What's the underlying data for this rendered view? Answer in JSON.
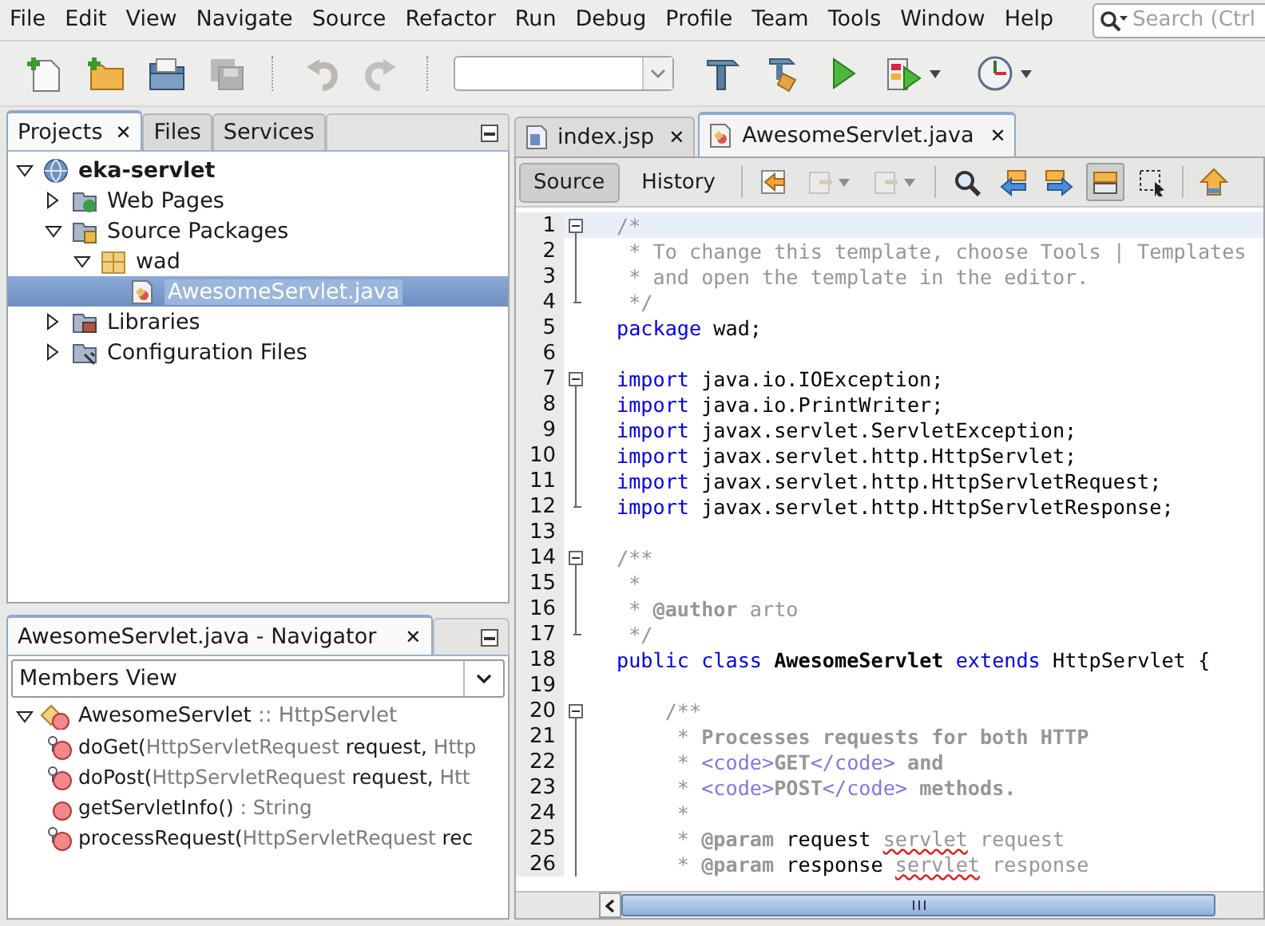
{
  "menu": [
    {
      "label": "File"
    },
    {
      "label": "Edit"
    },
    {
      "label": "View"
    },
    {
      "label": "Navigate"
    },
    {
      "label": "Source"
    },
    {
      "label": "Refactor"
    },
    {
      "label": "Run"
    },
    {
      "label": "Debug"
    },
    {
      "label": "Profile"
    },
    {
      "label": "Team"
    },
    {
      "label": "Tools"
    },
    {
      "label": "Window"
    },
    {
      "label": "Help"
    }
  ],
  "search": {
    "placeholder": "Search (Ctrl"
  },
  "toolbar": [
    {
      "kind": "button",
      "disabled": false
    },
    {
      "kind": "button",
      "disabled": false
    },
    {
      "kind": "button",
      "disabled": false
    },
    {
      "kind": "button",
      "disabled": true
    },
    {
      "kind": "separator"
    },
    {
      "kind": "button",
      "disabled": true
    },
    {
      "kind": "button",
      "disabled": true
    },
    {
      "kind": "separator"
    },
    {
      "kind": "combo"
    },
    {
      "kind": "button",
      "disabled": false
    },
    {
      "kind": "button",
      "disabled": false
    },
    {
      "kind": "button",
      "disabled": false
    },
    {
      "kind": "dropdown",
      "disabled": false
    },
    {
      "kind": "dropdown",
      "disabled": false
    }
  ],
  "projects_panel": {
    "tabs": [
      {
        "label": "Projects",
        "selected": true,
        "close": "✕"
      },
      {
        "label": "Files",
        "selected": false
      },
      {
        "label": "Services",
        "selected": false
      }
    ],
    "tree": [
      {
        "label": "eka-servlet",
        "kind": "project",
        "expanded": true,
        "selected": false,
        "children": [
          {
            "label": "Web Pages",
            "kind": "web",
            "expanded": false,
            "selected": false
          },
          {
            "label": "Source Packages",
            "kind": "sources",
            "expanded": true,
            "selected": false,
            "children": [
              {
                "label": "wad",
                "kind": "package",
                "expanded": true,
                "selected": false,
                "children": [
                  {
                    "label": "AwesomeServlet.java",
                    "kind": "java",
                    "selected": true
                  }
                ]
              }
            ]
          },
          {
            "label": "Libraries",
            "kind": "libraries",
            "expanded": false,
            "selected": false
          },
          {
            "label": "Configuration Files",
            "kind": "config",
            "expanded": false,
            "selected": false
          }
        ]
      }
    ]
  },
  "navigator": {
    "title": "AwesomeServlet.java - Navigator",
    "close": "✕",
    "view": "Members View",
    "class": {
      "name": "AwesomeServlet",
      "extends": ":: HttpServlet",
      "expanded": true
    },
    "members": [
      {
        "kind": "protected",
        "parts": [
          {
            "kind": "name",
            "text": "doGet("
          },
          {
            "kind": "type",
            "text": "HttpServletRequest"
          },
          {
            "kind": "name",
            "text": " request, "
          },
          {
            "kind": "type",
            "text": "Http"
          }
        ]
      },
      {
        "kind": "protected",
        "parts": [
          {
            "kind": "name",
            "text": "doPost("
          },
          {
            "kind": "type",
            "text": "HttpServletRequest"
          },
          {
            "kind": "name",
            "text": " request, "
          },
          {
            "kind": "type",
            "text": "Htt"
          }
        ]
      },
      {
        "kind": "public",
        "parts": [
          {
            "kind": "name",
            "text": "getServletInfo()"
          },
          {
            "kind": "type",
            "text": " : String"
          }
        ]
      },
      {
        "kind": "protected",
        "parts": [
          {
            "kind": "name",
            "text": "processRequest("
          },
          {
            "kind": "type",
            "text": "HttpServletRequest"
          },
          {
            "kind": "name",
            "text": " rec"
          }
        ]
      }
    ]
  },
  "editor": {
    "tabs": [
      {
        "label": "index.jsp",
        "kind": "jsp",
        "selected": false,
        "close": "✕"
      },
      {
        "label": "AwesomeServlet.java",
        "kind": "java",
        "selected": true,
        "close": "✕"
      }
    ],
    "views": [
      {
        "label": "Source",
        "selected": true
      },
      {
        "label": "History",
        "selected": false
      }
    ],
    "tools": [
      {
        "kind": "button",
        "pressed": false,
        "disabled": false
      },
      {
        "kind": "dropdown",
        "pressed": false,
        "disabled": true
      },
      {
        "kind": "dropdown",
        "pressed": false,
        "disabled": true
      },
      {
        "kind": "separator"
      },
      {
        "kind": "button",
        "pressed": false,
        "disabled": false
      },
      {
        "kind": "button",
        "pressed": false,
        "disabled": false
      },
      {
        "kind": "button",
        "pressed": false,
        "disabled": false
      },
      {
        "kind": "button",
        "pressed": true,
        "disabled": false
      },
      {
        "kind": "button",
        "pressed": false,
        "disabled": false
      },
      {
        "kind": "separator"
      },
      {
        "kind": "button",
        "pressed": false,
        "disabled": false
      }
    ],
    "lines": [
      {
        "number": "1",
        "fold_start": true,
        "fold_end": false,
        "current": true,
        "tokens": [
          {
            "kind": "comment",
            "text": "/*"
          }
        ]
      },
      {
        "number": "2",
        "fold_start": false,
        "fold_end": false,
        "current": false,
        "tokens": [
          {
            "kind": "comment",
            "text": " * To change this template, choose Tools | Templates"
          }
        ]
      },
      {
        "number": "3",
        "fold_start": false,
        "fold_end": false,
        "current": false,
        "tokens": [
          {
            "kind": "comment",
            "text": " * and open the template in the editor."
          }
        ]
      },
      {
        "number": "4",
        "fold_start": false,
        "fold_end": true,
        "current": false,
        "tokens": [
          {
            "kind": "comment",
            "text": " */"
          }
        ]
      },
      {
        "number": "5",
        "fold_start": false,
        "fold_end": false,
        "current": false,
        "tokens": [
          {
            "kind": "keyword",
            "text": "package"
          },
          {
            "kind": "plain",
            "text": " wad;"
          }
        ]
      },
      {
        "number": "6",
        "fold_start": false,
        "fold_end": false,
        "current": false
      },
      {
        "number": "7",
        "fold_start": true,
        "fold_end": false,
        "current": false,
        "tokens": [
          {
            "kind": "keyword",
            "text": "import"
          },
          {
            "kind": "plain",
            "text": " java.io.IOException;"
          }
        ]
      },
      {
        "number": "8",
        "fold_start": false,
        "fold_end": false,
        "current": false,
        "tokens": [
          {
            "kind": "keyword",
            "text": "import"
          },
          {
            "kind": "plain",
            "text": " java.io.PrintWriter;"
          }
        ]
      },
      {
        "number": "9",
        "fold_start": false,
        "fold_end": false,
        "current": false,
        "tokens": [
          {
            "kind": "keyword",
            "text": "import"
          },
          {
            "kind": "plain",
            "text": " javax.servlet.ServletException;"
          }
        ]
      },
      {
        "number": "10",
        "fold_start": false,
        "fold_end": false,
        "current": false,
        "tokens": [
          {
            "kind": "keyword",
            "text": "import"
          },
          {
            "kind": "plain",
            "text": " javax.servlet.http.HttpServlet;"
          }
        ]
      },
      {
        "number": "11",
        "fold_start": false,
        "fold_end": false,
        "current": false,
        "tokens": [
          {
            "kind": "keyword",
            "text": "import"
          },
          {
            "kind": "plain",
            "text": " javax.servlet.http.HttpServletRequest;"
          }
        ]
      },
      {
        "number": "12",
        "fold_start": false,
        "fold_end": true,
        "current": false,
        "tokens": [
          {
            "kind": "keyword",
            "text": "import"
          },
          {
            "kind": "plain",
            "text": " javax.servlet.http.HttpServletResponse;"
          }
        ]
      },
      {
        "number": "13",
        "fold_start": false,
        "fold_end": false,
        "current": false
      },
      {
        "number": "14",
        "fold_start": true,
        "fold_end": false,
        "current": false,
        "tokens": [
          {
            "kind": "comment",
            "text": "/**"
          }
        ]
      },
      {
        "number": "15",
        "fold_start": false,
        "fold_end": false,
        "current": false,
        "tokens": [
          {
            "kind": "comment",
            "text": " *"
          }
        ]
      },
      {
        "number": "16",
        "fold_start": false,
        "fold_end": false,
        "current": false,
        "tokens": [
          {
            "kind": "comment",
            "text": " * "
          },
          {
            "kind": "doctag",
            "text": "@author"
          },
          {
            "kind": "comment",
            "text": " arto"
          }
        ]
      },
      {
        "number": "17",
        "fold_start": false,
        "fold_end": true,
        "current": false,
        "tokens": [
          {
            "kind": "comment",
            "text": " */"
          }
        ]
      },
      {
        "number": "18",
        "fold_start": false,
        "fold_end": false,
        "current": false,
        "tokens": [
          {
            "kind": "keyword",
            "text": "public class "
          },
          {
            "kind": "declaration",
            "text": "AwesomeServlet"
          },
          {
            "kind": "keyword",
            "text": " extends"
          },
          {
            "kind": "plain",
            "text": " HttpServlet {"
          }
        ]
      },
      {
        "number": "19",
        "fold_start": false,
        "fold_end": false,
        "current": false
      },
      {
        "number": "20",
        "fold_start": true,
        "fold_end": false,
        "current": false,
        "tokens": [
          {
            "kind": "comment",
            "text": "    /**"
          }
        ]
      },
      {
        "number": "21",
        "fold_start": false,
        "fold_end": false,
        "current": false,
        "tokens": [
          {
            "kind": "comment",
            "text": "     * "
          },
          {
            "kind": "doctag",
            "text": "Processes requests for both HTTP"
          }
        ]
      },
      {
        "number": "22",
        "fold_start": false,
        "fold_end": false,
        "current": false,
        "tokens": [
          {
            "kind": "comment",
            "text": "     * "
          },
          {
            "kind": "htmltag",
            "text": "<code>"
          },
          {
            "kind": "doctag",
            "text": "GET"
          },
          {
            "kind": "htmltag",
            "text": "</code>"
          },
          {
            "kind": "doctag",
            "text": " and"
          }
        ]
      },
      {
        "number": "23",
        "fold_start": false,
        "fold_end": false,
        "current": false,
        "tokens": [
          {
            "kind": "comment",
            "text": "     * "
          },
          {
            "kind": "htmltag",
            "text": "<code>"
          },
          {
            "kind": "doctag",
            "text": "POST"
          },
          {
            "kind": "htmltag",
            "text": "</code>"
          },
          {
            "kind": "doctag",
            "text": " methods."
          }
        ]
      },
      {
        "number": "24",
        "fold_start": false,
        "fold_end": false,
        "current": false,
        "tokens": [
          {
            "kind": "comment",
            "text": "     *"
          }
        ]
      },
      {
        "number": "25",
        "fold_start": false,
        "fold_end": false,
        "current": false,
        "tokens": [
          {
            "kind": "comment",
            "text": "     * "
          },
          {
            "kind": "doctag",
            "text": "@param"
          },
          {
            "kind": "plain",
            "text": " request "
          },
          {
            "kind": "misspelled",
            "text": "servlet"
          },
          {
            "kind": "comment",
            "text": " request"
          }
        ]
      },
      {
        "number": "26",
        "fold_start": false,
        "fold_end": false,
        "current": false,
        "tokens": [
          {
            "kind": "comment",
            "text": "     * "
          },
          {
            "kind": "doctag",
            "text": "@param"
          },
          {
            "kind": "plain",
            "text": " response "
          },
          {
            "kind": "misspelled",
            "text": "servlet"
          },
          {
            "kind": "comment",
            "text": " response"
          }
        ]
      }
    ]
  }
}
